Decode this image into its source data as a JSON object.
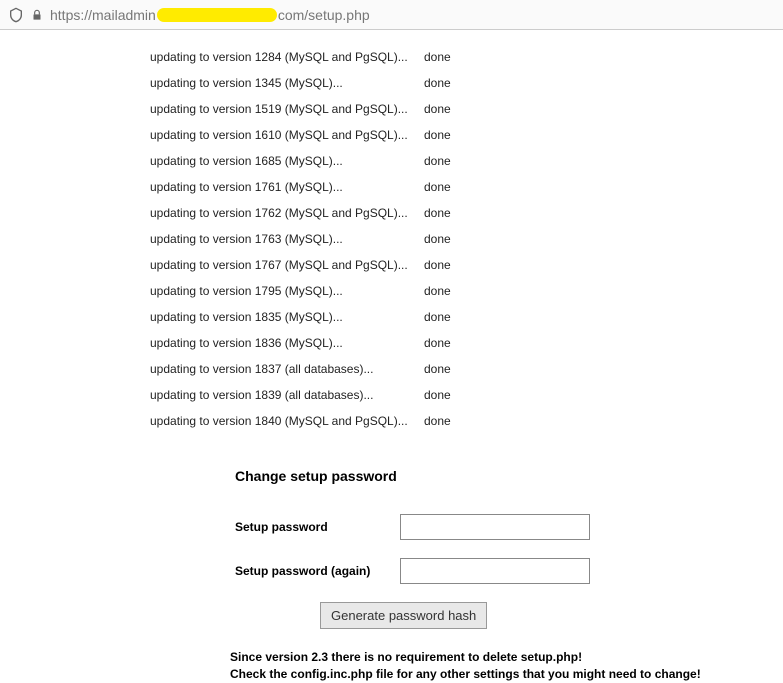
{
  "url": {
    "prefix": "https://mailadmin",
    "suffix": "com/setup.php"
  },
  "logs": [
    {
      "msg": "updating to version 1284 (MySQL and PgSQL)...",
      "status": "done"
    },
    {
      "msg": "updating to version 1345 (MySQL)...",
      "status": "done"
    },
    {
      "msg": "updating to version 1519 (MySQL and PgSQL)...",
      "status": "done"
    },
    {
      "msg": "updating to version 1610 (MySQL and PgSQL)...",
      "status": "done"
    },
    {
      "msg": "updating to version 1685 (MySQL)...",
      "status": "done"
    },
    {
      "msg": "updating to version 1761 (MySQL)...",
      "status": "done"
    },
    {
      "msg": "updating to version 1762 (MySQL and PgSQL)...",
      "status": "done"
    },
    {
      "msg": "updating to version 1763 (MySQL)...",
      "status": "done"
    },
    {
      "msg": "updating to version 1767 (MySQL and PgSQL)...",
      "status": "done"
    },
    {
      "msg": "updating to version 1795 (MySQL)...",
      "status": "done"
    },
    {
      "msg": "updating to version 1835 (MySQL)...",
      "status": "done"
    },
    {
      "msg": "updating to version 1836 (MySQL)...",
      "status": "done"
    },
    {
      "msg": "updating to version 1837 (all databases)...",
      "status": "done"
    },
    {
      "msg": "updating to version 1839 (all databases)...",
      "status": "done"
    },
    {
      "msg": "updating to version 1840 (MySQL and PgSQL)...",
      "status": "done"
    }
  ],
  "form": {
    "heading": "Change setup password",
    "label_password": "Setup password",
    "label_password_again": "Setup password (again)",
    "button": "Generate password hash"
  },
  "footer": {
    "line1": "Since version 2.3 there is no requirement to delete setup.php!",
    "line2": "Check the config.inc.php file for any other settings that you might need to change!"
  }
}
